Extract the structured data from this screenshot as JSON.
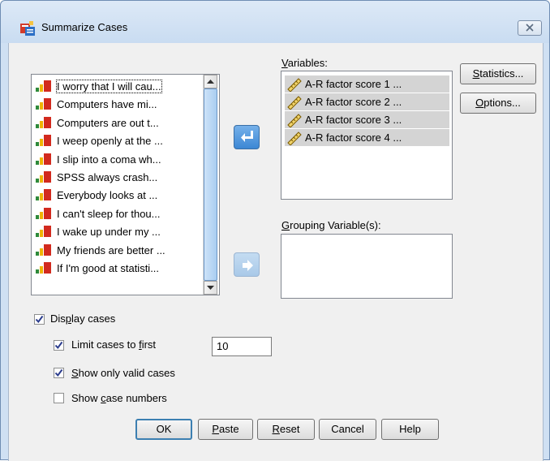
{
  "window": {
    "title": "Summarize Cases"
  },
  "source_list": {
    "items": [
      "I worry that I will cau...",
      "Computers have mi...",
      "Computers are out t...",
      "I weep openly at the ...",
      "I slip into a coma wh...",
      "SPSS always crash...",
      "Everybody looks at ...",
      "I can't sleep for thou...",
      "I wake up under my ...",
      "My friends are better ...",
      "If I'm good at statisti..."
    ]
  },
  "variables": {
    "label": "Variables:",
    "items": [
      "A-R  factor score   1 ...",
      "A-R  factor score   2 ...",
      "A-R  factor score   3 ...",
      "A-R  factor score   4 ..."
    ]
  },
  "grouping": {
    "label": "Grouping Variable(s):"
  },
  "side_buttons": {
    "statistics": "Statistics...",
    "options": "Options..."
  },
  "options": {
    "display_cases": {
      "label": "Display cases",
      "checked": true
    },
    "limit_cases": {
      "label": "Limit cases to first",
      "checked": true,
      "value": "10"
    },
    "valid_only": {
      "label": "Show only valid cases",
      "checked": true
    },
    "case_numbers": {
      "label": "Show case numbers",
      "checked": false
    }
  },
  "footer": {
    "ok": "OK",
    "paste": "Paste",
    "reset": "Reset",
    "cancel": "Cancel",
    "help": "Help"
  },
  "icons": {
    "app": "summarize-app-icon",
    "close": "close-x-icon",
    "ordinal": "ordinal-bar-icon",
    "scale": "ruler-icon",
    "move_left": "arrow-left-icon",
    "move_right": "arrow-right-icon"
  }
}
